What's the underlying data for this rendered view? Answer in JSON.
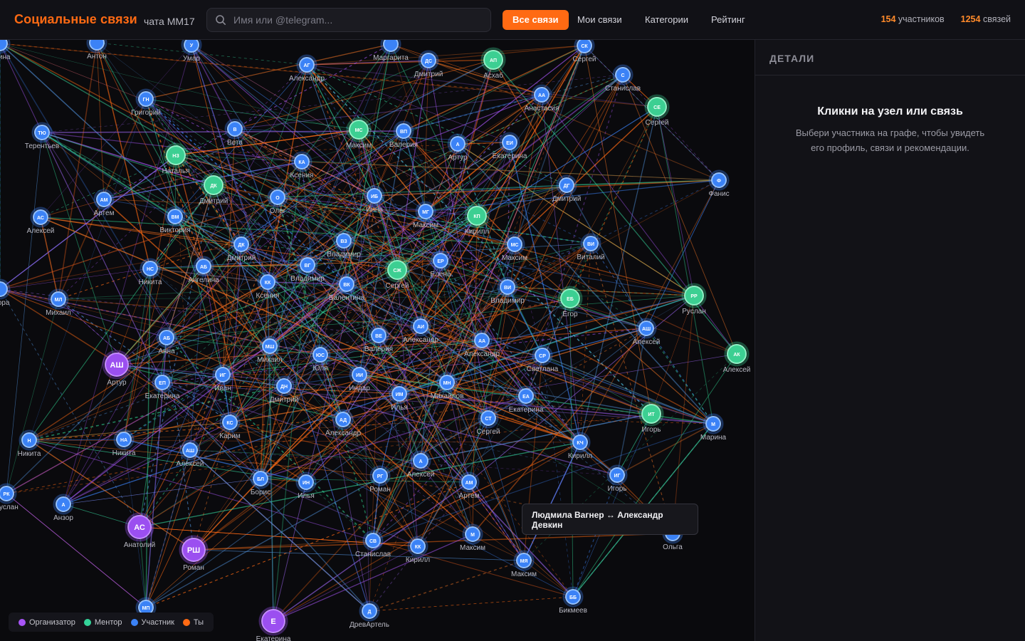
{
  "header": {
    "title": "Социальные связи",
    "subtitle": "чата ММ17",
    "search_placeholder": "Имя или @telegram...",
    "search_value": "",
    "nav": [
      {
        "label": "Все связи",
        "active": true
      },
      {
        "label": "Мои связи",
        "active": false
      },
      {
        "label": "Категории",
        "active": false
      },
      {
        "label": "Рейтинг",
        "active": false
      }
    ],
    "participants_count": "154",
    "participants_label": "участников",
    "links_count": "1254",
    "links_label": "связей"
  },
  "panel": {
    "heading": "ДЕТАЛИ",
    "title": "Кликни на узел или связь",
    "text": "Выбери участника на графе, чтобы увидеть его профиль, связи и рекомендации."
  },
  "tooltip": "Людмила Вагнер ↔ Александр Девкин",
  "legend": [
    {
      "label": "Организатор",
      "color": "#a855f7"
    },
    {
      "label": "Ментор",
      "color": "#34d399"
    },
    {
      "label": "Участник",
      "color": "#3b82f6"
    },
    {
      "label": "Ты",
      "color": "#ff6a13"
    }
  ],
  "colors": {
    "accent": "#ff6a13",
    "organizer": "#a855f7",
    "mentor": "#34d399",
    "participant": "#3b82f6"
  },
  "nodes": [
    {
      "i": "",
      "n": "Алина",
      "r": "p"
    },
    {
      "i": "",
      "n": "Антон",
      "r": "p"
    },
    {
      "i": "У",
      "n": "Умар",
      "r": "p"
    },
    {
      "i": "",
      "n": "Маргарита",
      "r": "p"
    },
    {
      "i": "ДС",
      "n": "Дмитрий",
      "r": "p"
    },
    {
      "i": "АП",
      "n": "Асхаб",
      "r": "m"
    },
    {
      "i": "СК",
      "n": "Сергей",
      "r": "p"
    },
    {
      "i": "АГ",
      "n": "Александр",
      "r": "p"
    },
    {
      "i": "С",
      "n": "Станислав",
      "r": "p"
    },
    {
      "i": "АА",
      "n": "Анастасия",
      "r": "p"
    },
    {
      "i": "СЕ",
      "n": "Сергей",
      "r": "m"
    },
    {
      "i": "ГН",
      "n": "Григорий",
      "r": "p"
    },
    {
      "i": "ТЮ",
      "n": "Терентьев",
      "r": "p"
    },
    {
      "i": "В",
      "n": "Вета",
      "r": "p"
    },
    {
      "i": "МС",
      "n": "Максим",
      "r": "m"
    },
    {
      "i": "ВП",
      "n": "Валерия",
      "r": "p"
    },
    {
      "i": "А",
      "n": "Артур",
      "r": "p"
    },
    {
      "i": "ЕИ",
      "n": "Екатерина",
      "r": "p"
    },
    {
      "i": "НЗ",
      "n": "Наталья",
      "r": "m"
    },
    {
      "i": "КА",
      "n": "Ксения",
      "r": "p"
    },
    {
      "i": "ДК",
      "n": "Дмитрий",
      "r": "m"
    },
    {
      "i": "Ф",
      "n": "Фанис",
      "r": "p"
    },
    {
      "i": "ДГ",
      "n": "Дмитрий",
      "r": "p"
    },
    {
      "i": "АМ",
      "n": "Артем",
      "r": "p"
    },
    {
      "i": "О",
      "n": "Олег",
      "r": "p"
    },
    {
      "i": "ИБ",
      "n": "Инна",
      "r": "p"
    },
    {
      "i": "МГ",
      "n": "Максим",
      "r": "p"
    },
    {
      "i": "КП",
      "n": "Кирилл",
      "r": "m"
    },
    {
      "i": "АС",
      "n": "Алексей",
      "r": "p"
    },
    {
      "i": "ВМ",
      "n": "Виктория",
      "r": "p"
    },
    {
      "i": "ДК",
      "n": "Дмитрий",
      "r": "p"
    },
    {
      "i": "ВЗ",
      "n": "Владимир",
      "r": "p"
    },
    {
      "i": "МС",
      "n": "Максим",
      "r": "p"
    },
    {
      "i": "ВИ",
      "n": "Виталий",
      "r": "p"
    },
    {
      "i": "НС",
      "n": "Никита",
      "r": "p"
    },
    {
      "i": "АБ",
      "n": "Ангелина",
      "r": "p"
    },
    {
      "i": "ВГ",
      "n": "Владимир",
      "r": "p"
    },
    {
      "i": "СЖ",
      "n": "Сергей",
      "r": "m"
    },
    {
      "i": "ЕР",
      "n": "Елена",
      "r": "p"
    },
    {
      "i": "РР",
      "n": "Руслан",
      "r": "m"
    },
    {
      "i": "",
      "n": "Егора",
      "r": "p"
    },
    {
      "i": "МЛ",
      "n": "Михаил",
      "r": "p"
    },
    {
      "i": "КК",
      "n": "Ксения",
      "r": "p"
    },
    {
      "i": "ВК",
      "n": "Валентина",
      "r": "p"
    },
    {
      "i": "ВИ",
      "n": "Владимир",
      "r": "p"
    },
    {
      "i": "ЕБ",
      "n": "Егор",
      "r": "m"
    },
    {
      "i": "АШ",
      "n": "Алексей",
      "r": "p"
    },
    {
      "i": "АШ",
      "n": "Артур",
      "r": "o"
    },
    {
      "i": "АБ",
      "n": "Анна",
      "r": "p"
    },
    {
      "i": "МШ",
      "n": "Михаил",
      "r": "p"
    },
    {
      "i": "ВЕ",
      "n": "Валерия",
      "r": "p"
    },
    {
      "i": "АИ",
      "n": "Александр",
      "r": "p"
    },
    {
      "i": "АА",
      "n": "Александр",
      "r": "p"
    },
    {
      "i": "АК",
      "n": "Алексей",
      "r": "m"
    },
    {
      "i": "ЮС",
      "n": "Юля",
      "r": "p"
    },
    {
      "i": "СР",
      "n": "Светлана",
      "r": "p"
    },
    {
      "i": "ЕП",
      "n": "Екатерина",
      "r": "p"
    },
    {
      "i": "ИГ",
      "n": "Иван",
      "r": "p"
    },
    {
      "i": "ИИ",
      "n": "Индар",
      "r": "p"
    },
    {
      "i": "ДН",
      "n": "Дмитрий",
      "r": "p"
    },
    {
      "i": "ИМ",
      "n": "Илья",
      "r": "p"
    },
    {
      "i": "МН",
      "n": "Михайлов",
      "r": "p"
    },
    {
      "i": "ЕА",
      "n": "Екатерина",
      "r": "p"
    },
    {
      "i": "ИТ",
      "n": "Игорь",
      "r": "m"
    },
    {
      "i": "КС",
      "n": "Карим",
      "r": "p"
    },
    {
      "i": "АД",
      "n": "Александр",
      "r": "p"
    },
    {
      "i": "СТ",
      "n": "Сергей",
      "r": "p"
    },
    {
      "i": "М",
      "n": "Марина",
      "r": "p"
    },
    {
      "i": "Н",
      "n": "Никита",
      "r": "p"
    },
    {
      "i": "НА",
      "n": "Никита",
      "r": "p"
    },
    {
      "i": "КЧ",
      "n": "Кирилл",
      "r": "p"
    },
    {
      "i": "АШ",
      "n": "Алексей",
      "r": "p"
    },
    {
      "i": "А",
      "n": "Алексей",
      "r": "p"
    },
    {
      "i": "БЛ",
      "n": "Борис",
      "r": "p"
    },
    {
      "i": "ИН",
      "n": "Илья",
      "r": "p"
    },
    {
      "i": "РГ",
      "n": "Роман",
      "r": "p"
    },
    {
      "i": "АМ",
      "n": "Артем",
      "r": "p"
    },
    {
      "i": "ИГ",
      "n": "Игорь",
      "r": "p"
    },
    {
      "i": "РК",
      "n": "Руслан",
      "r": "p"
    },
    {
      "i": "А",
      "n": "Анзор",
      "r": "p"
    },
    {
      "i": "АС",
      "n": "Анатолий",
      "r": "o"
    },
    {
      "i": "РШ",
      "n": "Роман",
      "r": "o"
    },
    {
      "i": "СВ",
      "n": "Станислав",
      "r": "p"
    },
    {
      "i": "КК",
      "n": "Кирилл",
      "r": "p"
    },
    {
      "i": "М",
      "n": "Максим",
      "r": "p"
    },
    {
      "i": "МЯ",
      "n": "Максим",
      "r": "p"
    },
    {
      "i": "",
      "n": "Ольга",
      "r": "p"
    },
    {
      "i": "ББ",
      "n": "Бикмеев",
      "r": "p"
    },
    {
      "i": "Д",
      "n": "ДревАртель",
      "r": "p"
    },
    {
      "i": "МП",
      "n": "",
      "r": "p"
    },
    {
      "i": "Е",
      "n": "Екатерина",
      "r": "o"
    }
  ]
}
